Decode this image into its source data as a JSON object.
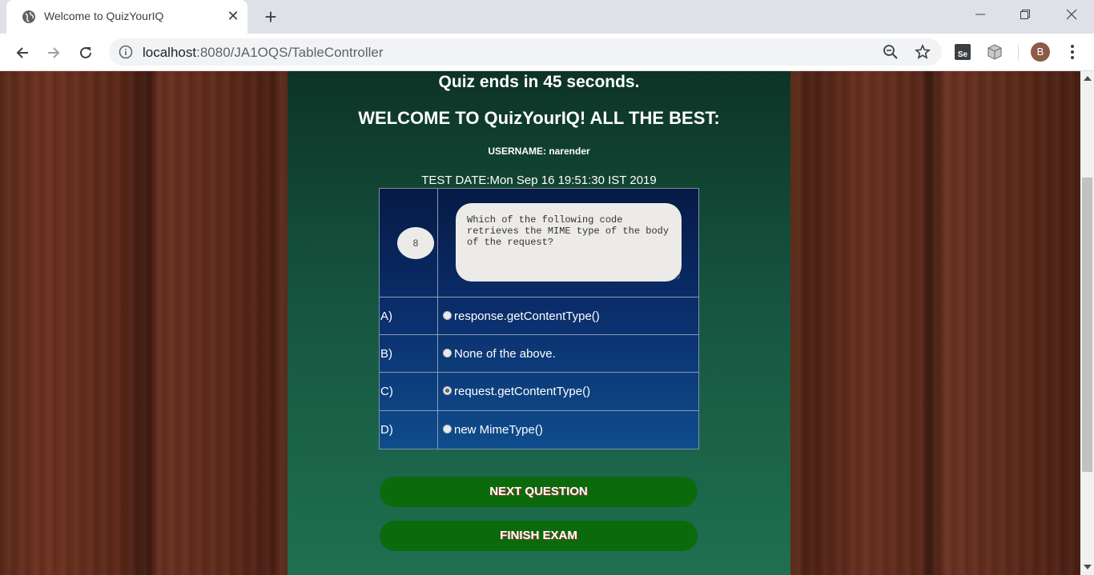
{
  "browser": {
    "tab_title": "Welcome to QuizYourIQ",
    "url_host": "localhost",
    "url_path": ":8080/JA1OQS/TableController",
    "profile_initial": "B"
  },
  "quiz": {
    "timer_text": "Quiz ends in 45 seconds.",
    "welcome_text": "WELCOME TO QuizYourIQ! ALL THE BEST:",
    "username_text": "USERNAME: narender",
    "test_date_text": "TEST DATE:Mon Sep 16 19:51:30 IST 2019",
    "question_number": "8",
    "question_text": "Which of the following code retrieves the MIME type of the body of the request?",
    "options": [
      {
        "letter": "A)",
        "label": "response.getContentType()"
      },
      {
        "letter": "B)",
        "label": "None of the above."
      },
      {
        "letter": "C)",
        "label": "request.getContentType()"
      },
      {
        "letter": "D)",
        "label": "new MimeType()"
      }
    ],
    "next_button": "NEXT QUESTION",
    "finish_button": "FINISH EXAM"
  }
}
